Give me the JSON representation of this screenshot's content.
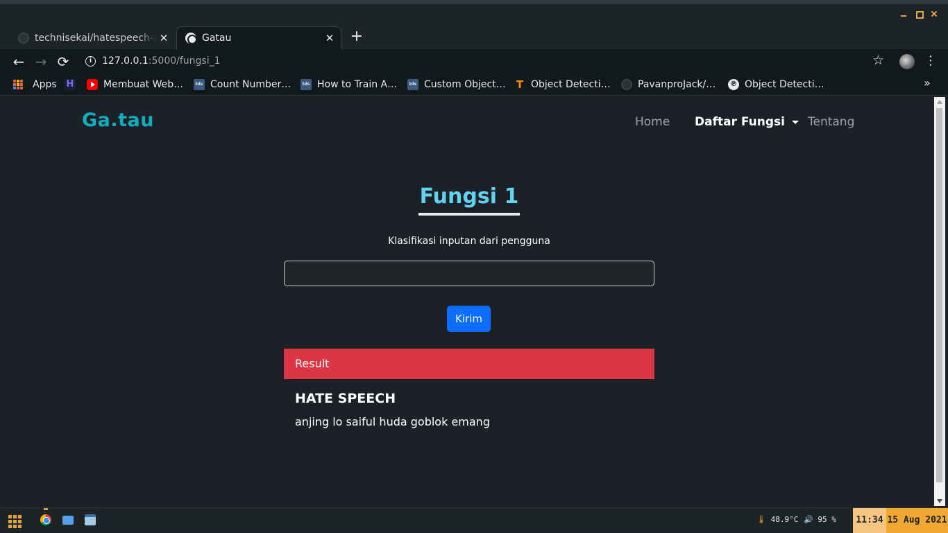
{
  "browser": {
    "tabs": [
      {
        "label": "technisekai/hatespeech-a"
      },
      {
        "label": "Gatau"
      }
    ],
    "new_tab_symbol": "+",
    "url_host": "127.0.0.1",
    "url_rest": ":5000/fungsi_1",
    "bookmarks": [
      {
        "label": "Apps",
        "icon": "apps-grid-icon"
      },
      {
        "label": "",
        "icon": "hostinger-icon"
      },
      {
        "label": "Membuat Web…",
        "icon": "youtube-icon"
      },
      {
        "label": "Count Number…",
        "icon": "tds-icon"
      },
      {
        "label": "How to Train A…",
        "icon": "tds-icon"
      },
      {
        "label": "Custom Object…",
        "icon": "tds-icon"
      },
      {
        "label": "Object Detecti…",
        "icon": "tensorflow-icon"
      },
      {
        "label": "PavanproJack/…",
        "icon": "github-icon"
      },
      {
        "label": "Object Detecti…",
        "icon": "pp-icon"
      }
    ],
    "bookmarks_overflow": "»"
  },
  "site": {
    "brand": "Ga.tau",
    "nav": {
      "home": "Home",
      "functions": "Daftar Fungsi",
      "about": "Tentang"
    }
  },
  "main": {
    "heading": "Fungsi 1",
    "subtitle": "Klasifikasi inputan dari pengguna",
    "input_value": "",
    "submit_label": "Kirim",
    "result_header": "Result",
    "result_title": "HATE SPEECH",
    "result_text": "anjing lo saiful huda goblok emang"
  },
  "taskbar": {
    "temperature": "48.9°C",
    "volume": "95 %",
    "time": "11:34",
    "date": "15 Aug 2021"
  },
  "colors": {
    "brand": "#11aebd",
    "heading": "#62d2f0",
    "button": "#0d6efd",
    "result_header": "#dc3545",
    "page_bg": "#1b2127"
  }
}
